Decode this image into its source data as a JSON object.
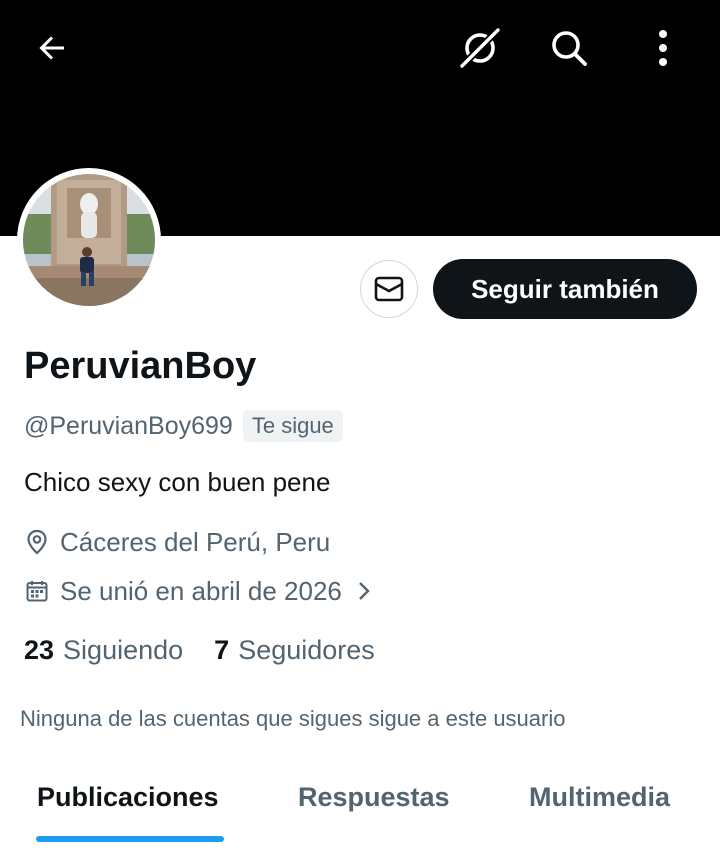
{
  "profile": {
    "display_name": "PeruvianBoy",
    "handle": "@PeruvianBoy699",
    "follows_you_badge": "Te sigue",
    "bio": "Chico sexy con buen pene",
    "location": "Cáceres del Perú, Peru",
    "joined": "Se unió en abril de 2026"
  },
  "actions": {
    "follow_back_label": "Seguir también"
  },
  "stats": {
    "following_count": "23",
    "following_label": "Siguiendo",
    "followers_count": "7",
    "followers_label": "Seguidores"
  },
  "mutuals_note": "Ninguna de las cuentas que sigues sigue a este usuario",
  "tabs": [
    {
      "label": "Publicaciones",
      "active": true
    },
    {
      "label": "Respuestas",
      "active": false
    },
    {
      "label": "Multimedia",
      "active": false
    }
  ],
  "icons": {
    "back": "arrow-left-icon",
    "grok": "grok-icon",
    "search": "search-icon",
    "more": "more-vertical-icon",
    "message": "envelope-icon",
    "location": "location-pin-icon",
    "calendar": "calendar-icon",
    "chevron": "chevron-right-icon"
  },
  "colors": {
    "banner": "#000000",
    "primary_text": "#0f1419",
    "secondary_text": "#536471",
    "accent": "#1d9bf0",
    "button_dark": "#0f1419",
    "badge_bg": "#eff3f4",
    "border": "#cfd9de"
  }
}
